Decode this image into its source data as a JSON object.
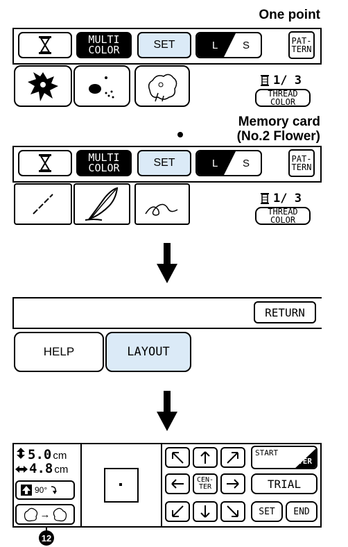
{
  "labels": {
    "one_point": "One point",
    "memory_card_line1": "Memory card",
    "memory_card_line2": "(No.2 Flower)",
    "callout": "12"
  },
  "toolbar": {
    "multi_line1": "MULTI",
    "multi_line2": "COLOR",
    "set": "SET",
    "size_l": "L",
    "size_s": "S",
    "pattern_line1": "PAT-",
    "pattern_line2": "TERN"
  },
  "thread": {
    "count": "1/ 3",
    "color_line1": "THREAD",
    "color_line2": "COLOR"
  },
  "menu": {
    "return": "RETURN",
    "help": "HELP",
    "layout": "LAYOUT"
  },
  "layout_screen": {
    "height_value": "5.0",
    "width_value": "4.8",
    "unit": "cm",
    "rotate_label": "90°",
    "center_line1": "CEN-",
    "center_line2": "TER",
    "start_label": "START",
    "center_label": "CENTER",
    "trial": "TRIAL",
    "set": "SET",
    "end": "END"
  },
  "icons": {
    "hourglass": "hourglass-icon",
    "down_arrow": "down-arrow-icon",
    "spool": "spool-icon"
  },
  "colors": {
    "accent": "#dbeaf7",
    "ink": "#000000"
  }
}
